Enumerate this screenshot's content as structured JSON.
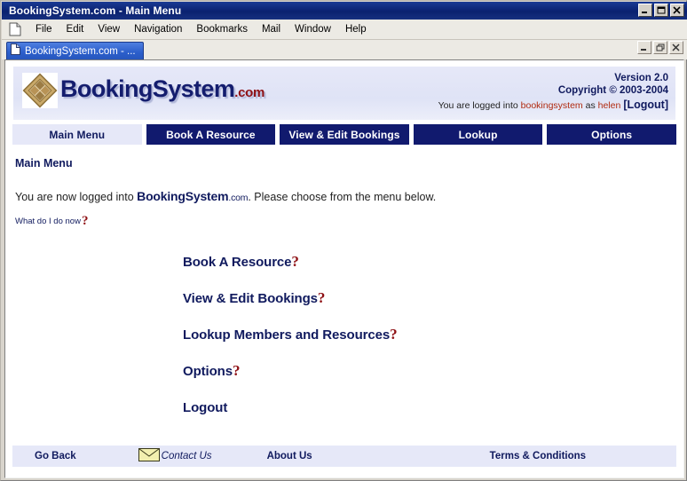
{
  "window": {
    "title": "BookingSystem.com - Main Menu",
    "minimize_label": "Minimize",
    "maximize_label": "Maximize",
    "close_label": "Close"
  },
  "menubar": {
    "items": [
      {
        "label": "File"
      },
      {
        "label": "Edit"
      },
      {
        "label": "View"
      },
      {
        "label": "Navigation"
      },
      {
        "label": "Bookmarks"
      },
      {
        "label": "Mail"
      },
      {
        "label": "Window"
      },
      {
        "label": "Help"
      }
    ]
  },
  "tabstrip": {
    "tab_label": "BookingSystem.com - ...",
    "mdi_minimize_label": "Minimize",
    "mdi_restore_label": "Restore",
    "mdi_close_label": "Close"
  },
  "header": {
    "logo_main": "BookingSystem",
    "logo_suffix": ".com",
    "version": "Version 2.0",
    "copyright": "Copyright © 2003-2004",
    "login_prefix": "You are now logged into",
    "login_text_pre": "You are logged into",
    "login_system": "bookingsystem",
    "login_as": "as",
    "login_user": "helen",
    "logout_label": "[Logout]"
  },
  "nav": {
    "tabs": [
      {
        "label": "Main Menu",
        "active": true
      },
      {
        "label": "Book A Resource",
        "active": false
      },
      {
        "label": "View & Edit Bookings",
        "active": false
      },
      {
        "label": "Lookup",
        "active": false
      },
      {
        "label": "Options",
        "active": false
      }
    ]
  },
  "main": {
    "page_title": "Main Menu",
    "intro_pre": "You are now logged into ",
    "intro_brand": "BookingSystem",
    "intro_brand_suffix": ".com",
    "intro_post": ". Please choose from the menu below.",
    "help_label": "What do I do now",
    "help_icon": "question-mark-icon",
    "menu_items": [
      {
        "label": "Book A Resource",
        "has_help": true
      },
      {
        "label": "View & Edit Bookings",
        "has_help": true
      },
      {
        "label": "Lookup Members and Resources",
        "has_help": true
      },
      {
        "label": "Options",
        "has_help": true
      },
      {
        "label": "Logout",
        "has_help": false
      }
    ]
  },
  "footer": {
    "go_back": "Go Back",
    "contact_us": "Contact Us",
    "about_us": "About Us",
    "terms": "Terms & Conditions",
    "envelope_icon": "envelope-icon"
  },
  "colors": {
    "navy": "#111a6e",
    "header_band": "#e6e8f8",
    "accent_red": "#8e1014",
    "titlebar_blue": "#0a2170"
  }
}
